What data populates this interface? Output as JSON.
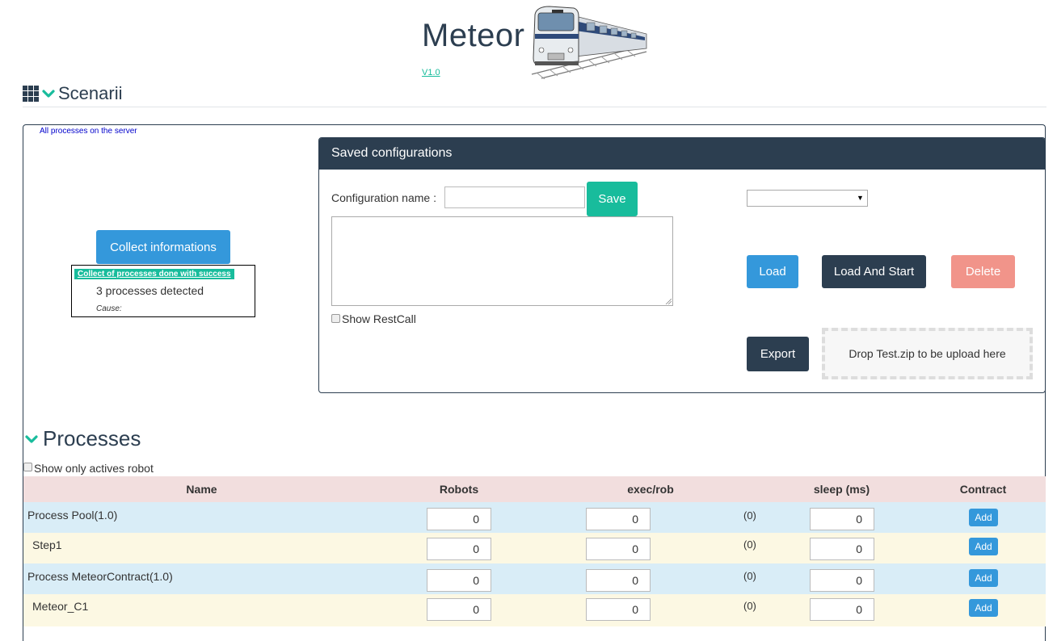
{
  "header": {
    "title": "Meteor",
    "version": "V1.0",
    "section_title": "Scenarii"
  },
  "collect": {
    "all_processes_link": "All processes on the server",
    "button_label": "Collect informations",
    "success_label": "Collect of processes done with success",
    "detected_text": "3 processes detected",
    "cause_label": "Cause:"
  },
  "config": {
    "panel_title": "Saved configurations",
    "name_label": "Configuration name :",
    "name_value": "",
    "textarea_value": "",
    "save_label": "Save",
    "show_restcall_label": "Show RestCall",
    "show_restcall_checked": false,
    "select_value": "",
    "load_label": "Load",
    "load_start_label": "Load And Start",
    "delete_label": "Delete",
    "export_label": "Export",
    "drop_zone_text": "Drop Test.zip to be upload here"
  },
  "processes": {
    "title": "Processes",
    "show_active_label": "Show only actives robot",
    "show_active_checked": false,
    "columns": [
      "Name",
      "Robots",
      "exec/rob",
      "sleep (ms)",
      "Contract"
    ],
    "rows": [
      {
        "name": "Process Pool(1.0)",
        "robots": "0",
        "exec": "0",
        "exec_total": "(0)",
        "sleep": "0",
        "action": "Add"
      },
      {
        "name": "Step1",
        "robots": "0",
        "exec": "0",
        "exec_total": "(0)",
        "sleep": "0",
        "action": "Add"
      },
      {
        "name": "Process MeteorContract(1.0)",
        "robots": "0",
        "exec": "0",
        "exec_total": "(0)",
        "sleep": "0",
        "action": "Add"
      },
      {
        "name": "Meteor_C1",
        "robots": "0",
        "exec": "0",
        "exec_total": "(0)",
        "sleep": "0",
        "action": "Add"
      }
    ]
  },
  "colors": {
    "primary_dark": "#2c3e50",
    "success": "#18bc9c",
    "info": "#3498db",
    "danger": "#f1948a",
    "row_info": "#d9edf7",
    "row_warn": "#fcf8e3",
    "header_row": "#f2dede"
  },
  "icons": {
    "grid": "grid-icon",
    "chevron": "chevron-down-icon",
    "logo": "train-logo"
  }
}
